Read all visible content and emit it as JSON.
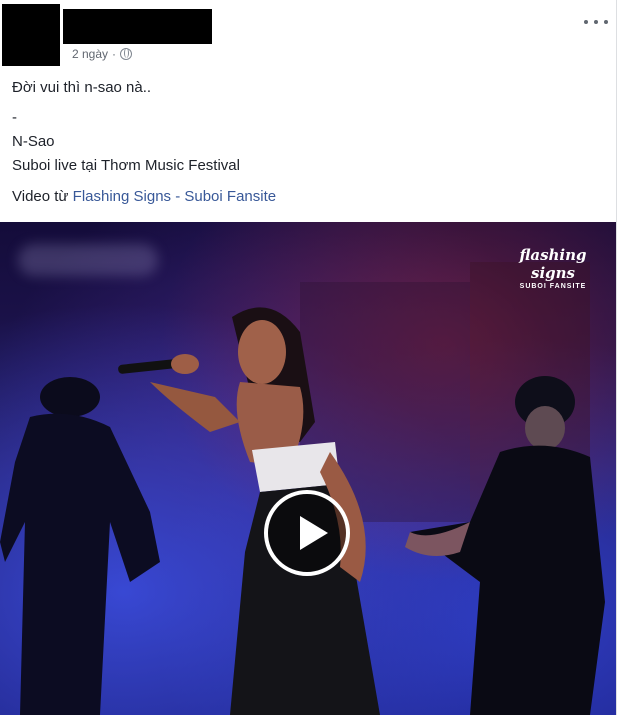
{
  "post": {
    "timestamp": "2 ngày",
    "caption": "Đời vui thì n-sao nà..",
    "separator": "-",
    "song_title": "N-Sao",
    "event_line": "Suboi live tại Thơm Music Festival",
    "via_prefix": "Video từ",
    "via_link": "Flashing Signs - Suboi Fansite"
  },
  "video": {
    "watermark_main": "flashing signs",
    "watermark_sub": "SUBOI FANSITE"
  },
  "icons": {
    "privacy": "globe-icon",
    "menu": "more-options-icon",
    "play": "play-icon"
  },
  "colors": {
    "link": "#385898",
    "meta": "#616770",
    "text": "#1d2129"
  }
}
